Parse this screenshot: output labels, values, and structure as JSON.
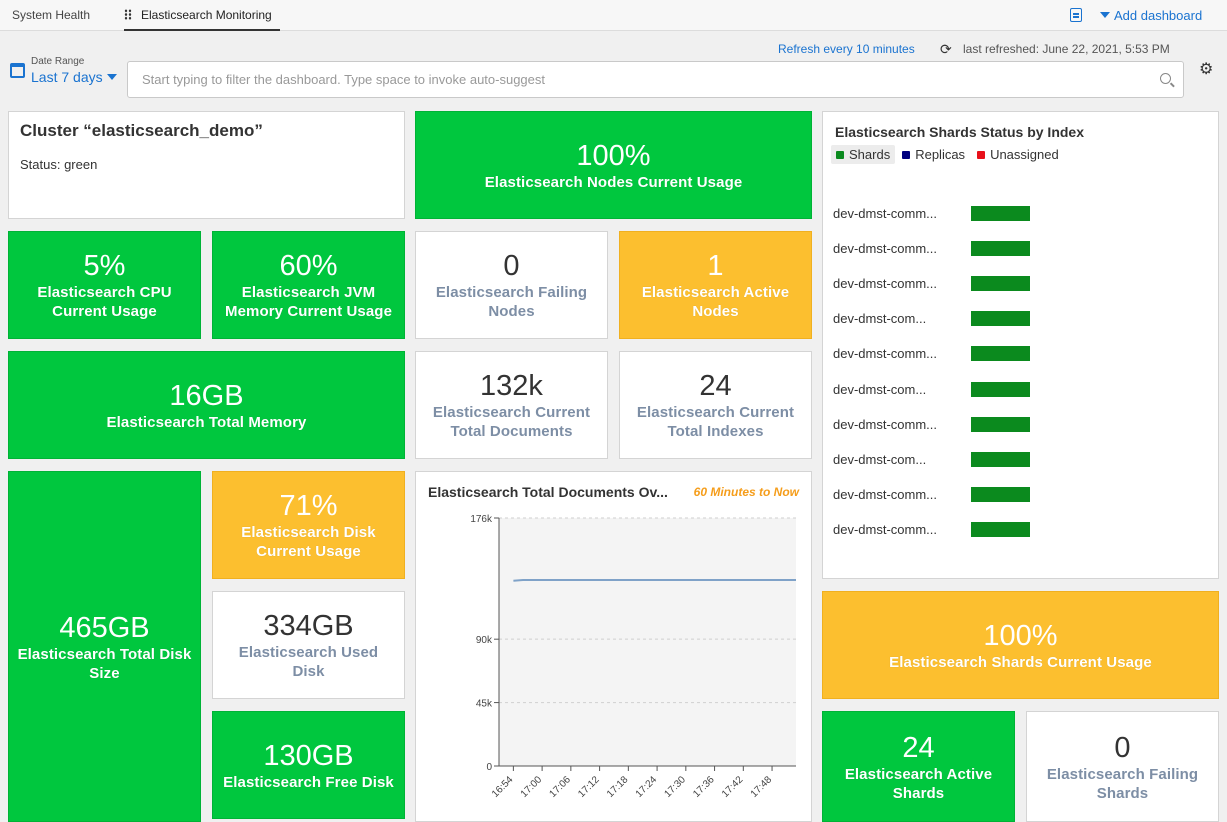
{
  "tabs": [
    "System Health",
    "Elasticsearch Monitoring"
  ],
  "header": {
    "add_dashboard": "Add dashboard",
    "notes_icon": "notes-icon"
  },
  "refresh": {
    "interval": "Refresh every 10 minutes",
    "last": "last refreshed: June 22, 2021, 5:53 PM"
  },
  "date_range": {
    "label": "Date Range",
    "value": "Last 7 days"
  },
  "search": {
    "placeholder": "Start typing to filter the dashboard. Type space to invoke auto-suggest"
  },
  "cluster": {
    "title": "Cluster “elasticsearch_demo”",
    "status": "Status: green"
  },
  "colors": {
    "green": "#00c73e",
    "amber": "#fcbf2f",
    "shards": "#0b8a1e",
    "replicas": "#00007f",
    "unassigned": "#e8101a",
    "link": "#1a73d0",
    "line": "#7fa2c8"
  },
  "tiles": {
    "nodes_usage": {
      "value": "100%",
      "label": "Elasticsearch Nodes Current Usage"
    },
    "cpu": {
      "value": "5%",
      "label": "Elasticsearch CPU Current Usage"
    },
    "jvm": {
      "value": "60%",
      "label": "Elasticsearch JVM Memory Current Usage"
    },
    "failing_nodes": {
      "value": "0",
      "label": "Elasticsearch Failing Nodes"
    },
    "active_nodes": {
      "value": "1",
      "label": "Elasticsearch Active Nodes"
    },
    "total_memory": {
      "value": "16GB",
      "label": "Elasticsearch Total Memory"
    },
    "total_documents": {
      "value": "132k",
      "label": "Elasticsearch Current Total Documents"
    },
    "total_indexes": {
      "value": "24",
      "label": "Elasticsearch Current Total Indexes"
    },
    "disk_size": {
      "value": "465GB",
      "label": "Elasticsearch Total Disk Size"
    },
    "disk_usage": {
      "value": "71%",
      "label": "Elasticsearch Disk Current Usage"
    },
    "used_disk": {
      "value": "334GB",
      "label": "Elasticsearch Used Disk"
    },
    "free_disk": {
      "value": "130GB",
      "label": "Elasticsearch Free Disk"
    },
    "shards_usage": {
      "value": "100%",
      "label": "Elasticsearch Shards Current Usage"
    },
    "active_shards": {
      "value": "24",
      "label": "Elasticsearch Active Shards"
    },
    "failing_shards": {
      "value": "0",
      "label": "Elasticsearch Failing Shards"
    }
  },
  "doc_chart": {
    "title": "Elasticsearch Total Documents Ov...",
    "range": "60 Minutes to Now"
  },
  "shards": {
    "title": "Elasticsearch Shards Status by Index",
    "legend": [
      "Shards",
      "Replicas",
      "Unassigned"
    ],
    "indexes": [
      "dev-dmst-comm...",
      "dev-dmst-comm...",
      "dev-dmst-comm...",
      "dev-dmst-com...",
      "dev-dmst-comm...",
      "dev-dmst-com...",
      "dev-dmst-comm...",
      "dev-dmst-com...",
      "dev-dmst-comm...",
      "dev-dmst-comm..."
    ]
  },
  "chart_data": {
    "type": "line",
    "title": "Elasticsearch Total Documents Ov...",
    "subtitle": "60 Minutes to Now",
    "x_ticks": [
      "16:54",
      "17:00",
      "17:06",
      "17:12",
      "17:18",
      "17:24",
      "17:30",
      "17:36",
      "17:42",
      "17:48"
    ],
    "y_ticks": [
      "0",
      "45k",
      "90k",
      "176k"
    ],
    "ylim": [
      0,
      176000
    ],
    "grid": true,
    "series": [
      {
        "x": [
          "16:54",
          "16:56",
          "17:00",
          "17:06",
          "17:12",
          "17:18",
          "17:24",
          "17:30",
          "17:36",
          "17:42",
          "17:48",
          "17:53"
        ],
        "values": [
          131500,
          132000,
          132000,
          132000,
          132000,
          132000,
          132000,
          132000,
          132000,
          132000,
          132000,
          132000
        ]
      }
    ]
  }
}
